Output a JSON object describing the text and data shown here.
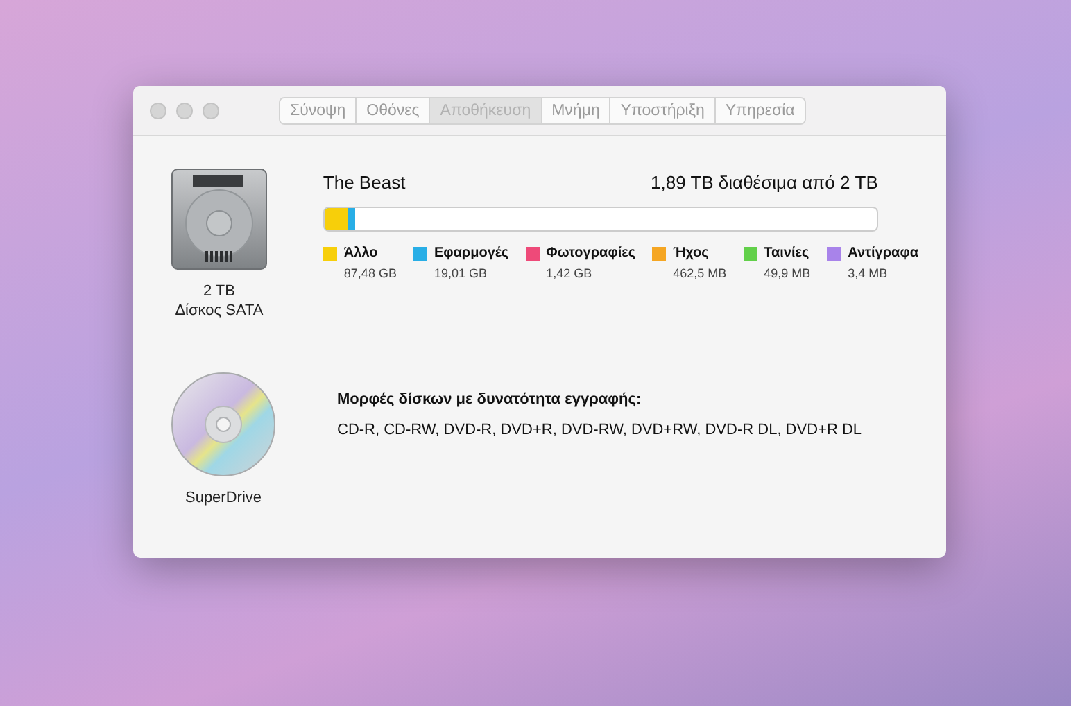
{
  "tabs": [
    {
      "label": "Σύνοψη",
      "selected": false
    },
    {
      "label": "Οθόνες",
      "selected": false
    },
    {
      "label": "Αποθήκευση",
      "selected": true
    },
    {
      "label": "Μνήμη",
      "selected": false
    },
    {
      "label": "Υποστήριξη",
      "selected": false
    },
    {
      "label": "Υπηρεσία",
      "selected": false
    }
  ],
  "devices": [
    {
      "kind": "disk",
      "caption": [
        "2 TB",
        "Δίσκος SATA"
      ],
      "volume_name": "The Beast",
      "capacity": "1,89 TB διαθέσιμα από 2 TB",
      "usage_bar": [
        {
          "color": "#f7cf0a",
          "level": 0.042
        },
        {
          "color": "#28aee6",
          "level": 0.055
        }
      ],
      "categories": [
        {
          "name": "Άλλο",
          "size": "87,48 GB",
          "color": "#f7cf0a"
        },
        {
          "name": "Εφαρμογές",
          "size": "19,01 GB",
          "color": "#28aee6"
        },
        {
          "name": "Φωτογραφίες",
          "size": "1,42 GB",
          "color": "#ee4a79"
        },
        {
          "name": "Ήχος",
          "size": "462,5 MB",
          "color": "#f5a623"
        },
        {
          "name": "Ταινίες",
          "size": "49,9 MB",
          "color": "#62d04a"
        },
        {
          "name": "Αντίγραφα",
          "size": "3,4 MB",
          "color": "#a883ea"
        }
      ]
    },
    {
      "kind": "optical",
      "caption": [
        "SuperDrive"
      ],
      "formats_title": "Μορφές δίσκων με δυνατότητα εγγραφής:",
      "formats": "CD-R, CD-RW, DVD-R, DVD+R, DVD-RW, DVD+RW, DVD-R DL, DVD+R DL"
    }
  ]
}
